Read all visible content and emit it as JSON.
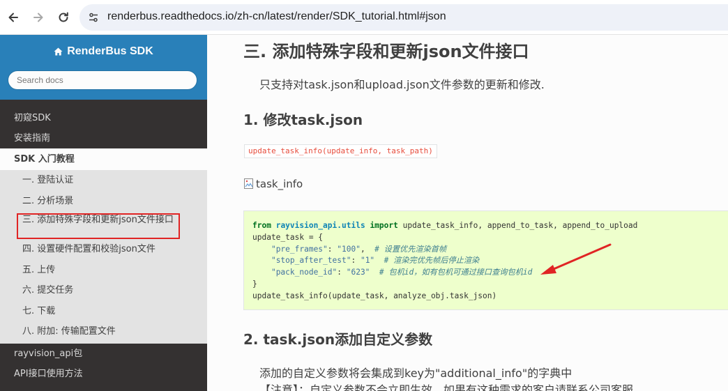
{
  "browser": {
    "url": "renderbus.readthedocs.io/zh-cn/latest/render/SDK_tutorial.html#json"
  },
  "sidebar": {
    "brand": "RenderBus SDK",
    "search_placeholder": "Search docs",
    "top_items": [
      "初窥SDK",
      "安装指南"
    ],
    "current": "SDK 入门教程",
    "sub_items": [
      "一. 登陆认证",
      "二. 分析场景",
      "三. 添加特殊字段和更新json文件接口",
      "四. 设置硬件配置和校验json文件",
      "五. 上传",
      "六. 提交任务",
      "七. 下载",
      "八. 附加: 传输配置文件"
    ],
    "bottom_items": [
      "rayvision_api包",
      "API接口使用方法"
    ]
  },
  "content": {
    "title": "三. 添加特殊字段和更新json文件接口",
    "intro": "只支持对task.json和upload.json文件参数的更新和修改.",
    "section1_title": "1. 修改task.json",
    "inline_code": "update_task_info(update_info, task_path)",
    "image_alt": "task_info",
    "code": {
      "l1_kw1": "from",
      "l1_mod": "rayvision_api.utils",
      "l1_kw2": "import",
      "l1_rest": " update_task_info, append_to_task, append_to_upload",
      "l2": "update_task = {",
      "l3_key": "\"pre_frames\"",
      "l3_val": "\"100\"",
      "l3_comment": "# 设置优先渲染首帧",
      "l4_key": "\"stop_after_test\"",
      "l4_val": "\"1\"",
      "l4_comment": "# 渲染完优先帧后停止渲染",
      "l5_key": "\"pack_node_id\"",
      "l5_val": "\"623\"",
      "l5_comment": "# 包机id，如有包机可通过接口查询包机id",
      "l6": "}",
      "l7": "update_task_info(update_task, analyze_obj.task_json)"
    },
    "section2_title": "2. task.json添加自定义参数",
    "para2_line1": "添加的自定义参数将会集成到key为\"additional_info\"的字典中",
    "para2_line2": "【注意】：自定义参数不会立即生效，如果有这种需求的客户请联系公司客服。"
  },
  "colors": {
    "sidebar_header": "#2980b9",
    "sidebar_bg": "#343131",
    "highlight_box": "#e02424",
    "code_bg": "#eeffcc",
    "arrow": "#e02424"
  }
}
